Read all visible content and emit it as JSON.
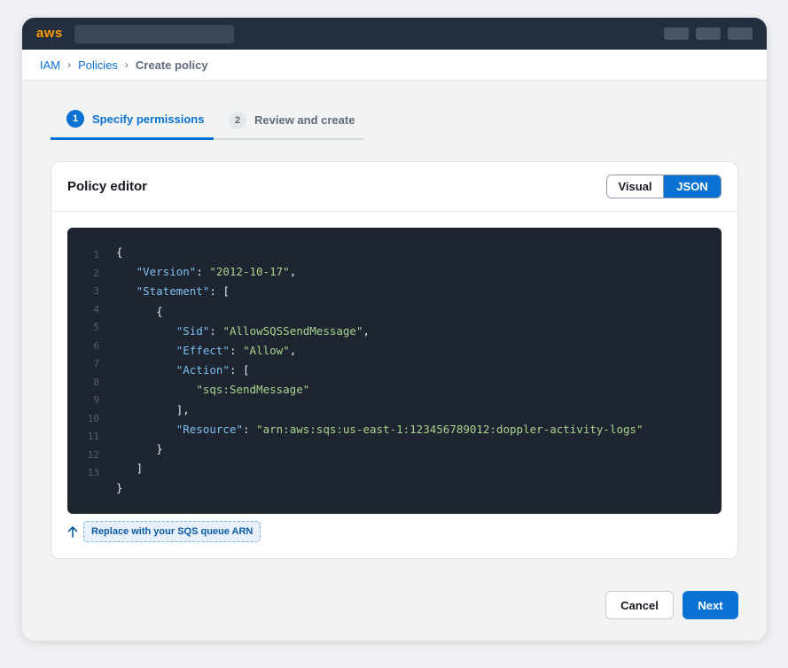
{
  "topbar": {
    "logo": "aws"
  },
  "breadcrumb": {
    "items": [
      "IAM",
      "Policies"
    ],
    "current": "Create policy",
    "separator": "›"
  },
  "steps": [
    {
      "number": "1",
      "label": "Specify permissions",
      "active": true
    },
    {
      "number": "2",
      "label": "Review and create",
      "active": false
    }
  ],
  "editor": {
    "title": "Policy editor",
    "toggle": {
      "visual": "Visual",
      "json": "JSON",
      "selected": "JSON"
    },
    "line_numbers": [
      "1",
      "2",
      "3",
      "4",
      "5",
      "6",
      "7",
      "8",
      "9",
      "10",
      "11",
      "12",
      "13"
    ],
    "code": {
      "open": "{",
      "version_key": "\"Version\"",
      "version_value": "\"2012-10-17\"",
      "statement_key": "\"Statement\"",
      "sid_key": "\"Sid\"",
      "sid_value": "\"AllowSQSSendMessage\"",
      "effect_key": "\"Effect\"",
      "effect_value": "\"Allow\"",
      "action_key": "\"Action\"",
      "action_value": "\"sqs:SendMessage\"",
      "resource_key": "\"Resource\"",
      "resource_value": "\"arn:aws:sqs:us-east-1:123456789012:doppler-activity-logs\""
    },
    "hint": "Replace with your SQS queue ARN"
  },
  "footer": {
    "cancel": "Cancel",
    "next": "Next"
  },
  "colors": {
    "accent": "#0972d3",
    "topbar": "#232f3e",
    "logo": "#ff9900",
    "code_bg": "#1e2430"
  }
}
